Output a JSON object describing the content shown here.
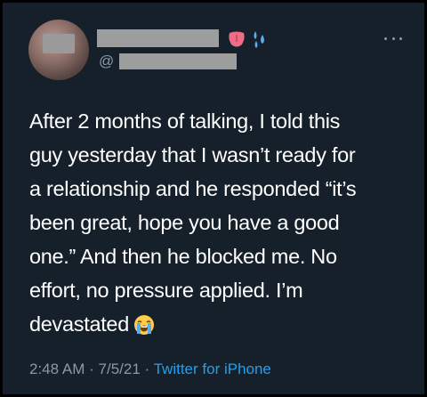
{
  "tweet": {
    "handle_prefix": "@",
    "name_emojis": [
      "tongue-emoji",
      "sweat-droplets-emoji"
    ],
    "body_lines": [
      "After 2 months of talking, I told this",
      "guy yesterday that I wasn’t ready for",
      "a relationship and he responded “it’s",
      "been great, hope you have a good",
      "one.” And then he blocked me. No",
      "effort, no pressure applied. I’m",
      "devastated"
    ],
    "trailing_emoji": "loudly-crying-face-emoji",
    "time": "2:48 AM",
    "separator": "·",
    "date": "7/5/21",
    "source": "Twitter for iPhone"
  },
  "colors": {
    "background": "#15202b",
    "text": "#ffffff",
    "secondary": "#8899a6",
    "link": "#1da1f2",
    "redaction": "#9d9d9d"
  },
  "icons": {
    "more": "more-options-icon"
  }
}
